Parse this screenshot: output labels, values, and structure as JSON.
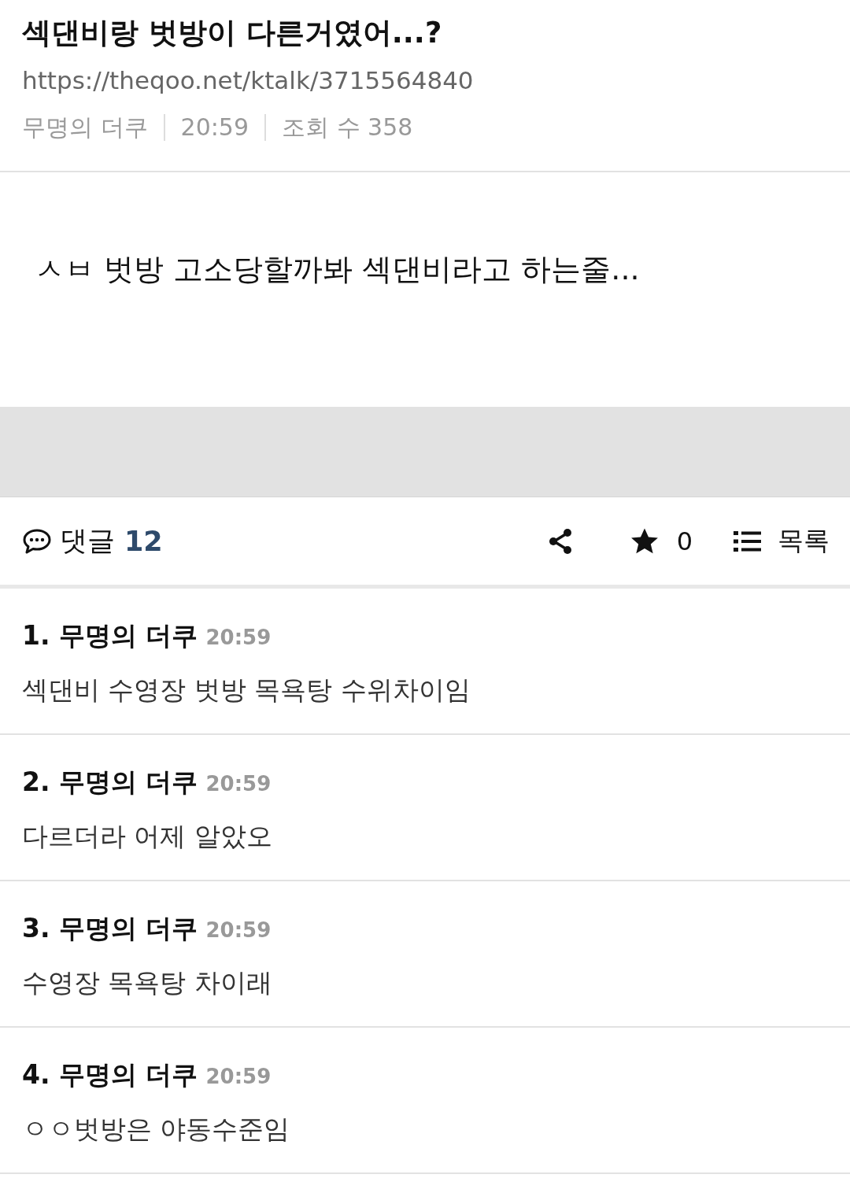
{
  "post": {
    "title": "섹댄비랑 벗방이 다른거였어...?",
    "url": "https://theqoo.net/ktalk/3715564840",
    "author": "무명의 더쿠",
    "time": "20:59",
    "views": "조회 수 358",
    "body": "ㅅㅂ 벗방 고소당할까봐 섹댄비라고 하는줄..."
  },
  "toolbar": {
    "comments_label": "댓글",
    "comments_count": "12",
    "star_count": "0",
    "list_label": "목록"
  },
  "comments": [
    {
      "header": "1. 무명의 더쿠",
      "time": "20:59",
      "text": "섹댄비 수영장 벗방 목욕탕 수위차이임"
    },
    {
      "header": "2. 무명의 더쿠",
      "time": "20:59",
      "text": "다르더라 어제 알았오"
    },
    {
      "header": "3. 무명의 더쿠",
      "time": "20:59",
      "text": "수영장 목욕탕 차이래"
    },
    {
      "header": "4. 무명의 더쿠",
      "time": "20:59",
      "text": "ㅇㅇ벗방은 야동수준임"
    }
  ]
}
